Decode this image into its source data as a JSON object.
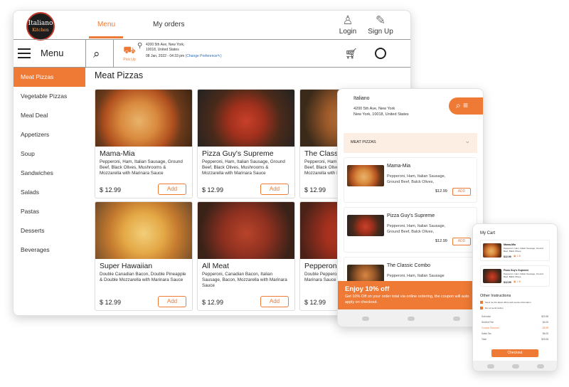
{
  "desktop": {
    "logo_text": "Italiano",
    "logo_sub": "Kitchen",
    "tabs": [
      {
        "label": "Menu"
      },
      {
        "label": "My orders"
      }
    ],
    "login_label": "Login",
    "signup_label": "Sign Up",
    "menu_label": "Menu",
    "pickup_label": "Pick Up",
    "address_line1": "4200 5th Ave, New York,",
    "address_line2": "10018, United States",
    "datetime": "08 Jan, 2022 - 04:33 pm",
    "change_pref": "(Change Preference",
    "sidebar": [
      "Meat Pizzas",
      "Vegetable Pizzas",
      "Meal Deal",
      "Appetizers",
      "Soup",
      "Sandwiches",
      "Salads",
      "Pastas",
      "Desserts",
      "Beverages"
    ],
    "section_title": "Meat Pizzas",
    "add_label": "Add",
    "products": [
      {
        "name": "Mama-Mia",
        "desc": "Pepperoni, Ham, Italian Sausage, Ground Beef, Black Olives, Mushrooms & Mozzarella with Marinara Sauce",
        "price": "$ 12.99"
      },
      {
        "name": "Pizza Guy's Supreme",
        "desc": "Pepperoni, Ham, Italian Sausage, Ground Beef, Black Olives, Mushrooms & Mozzarella with Marinara Sauce",
        "price": "$ 12.99"
      },
      {
        "name": "The Classic Combo",
        "desc": "Pepperoni, Ham, Italian Sausage, Ground Beef, Black Olives, Mushrooms & Mozzarella with Marinara Sauce",
        "price": "$ 12.99"
      },
      {
        "name": "Super Hawaiian",
        "desc": "Double Canadian Bacon, Double Pineapple & Double Mozzarella with Marinara Sauce",
        "price": "$ 12.99"
      },
      {
        "name": "All Meat",
        "desc": "Pepperoni, Canadian Bacon, Italian Sausage, Bacon, Mozzarella with Marinara Sauce",
        "price": "$ 12.99"
      },
      {
        "name": "Pepperoni",
        "desc": "Double Pepperoni & Double Mozzarella with Marinara Sauce",
        "price": "$ 12.99"
      }
    ]
  },
  "tablet": {
    "title": "Italiano",
    "address_line1": "4200 5th Ave, New York",
    "address_line2": "New York, 10018, United States",
    "category": "MEAT PIZZAS",
    "add_label": "ADD",
    "items": [
      {
        "name": "Mama-Mia",
        "desc1": "Pepperoni, Ham, Italian Sausage,",
        "desc2": "Ground Beef, Balck Olives,",
        "price": "$12.99"
      },
      {
        "name": "Pizza Guy's Supreme",
        "desc1": "Pepperoni, Ham, Italian Sausage,",
        "desc2": "Ground Beef, Balck Olives,",
        "price": "$12.99"
      },
      {
        "name": "The Classic Combo",
        "desc1": "Pepperoni, Ham, Italian Sausage",
        "desc2": "",
        "price": ""
      }
    ],
    "promo_title": "Enjoy 10% off",
    "promo_desc": "Get 10% Off on your order total via online ordering, the coupon will auto apply on checkout."
  },
  "phone": {
    "title": "My Cart",
    "items": [
      {
        "name": "Mama-Mia",
        "desc": "Pepperoni, Ham, Italian Sausage, Ground Beef, Balck Olives,",
        "price": "$12.99",
        "qty": "1"
      },
      {
        "name": "Pizza Guy's Supreme",
        "desc": "Pepperoni, Ham, Italian Sausage, Ground Beef, Balck Olives,",
        "price": "$12.99",
        "qty": "1"
      }
    ],
    "other_instructions": "Other Instructions",
    "option1": "Send me the latest offers and events information",
    "option2": "Do not send cutlery",
    "totals": [
      {
        "label": "Sub total",
        "value": "$23.98"
      },
      {
        "label": "Service Fee",
        "value": "$4.00"
      },
      {
        "label": "Coupon Discount",
        "value": "-$8.98"
      },
      {
        "label": "Sales Tax",
        "value": "$6.00"
      },
      {
        "label": "Total",
        "value": "$33.08"
      }
    ],
    "checkout_label": "Checkout"
  },
  "colors": {
    "accent": "#ee7a35"
  }
}
